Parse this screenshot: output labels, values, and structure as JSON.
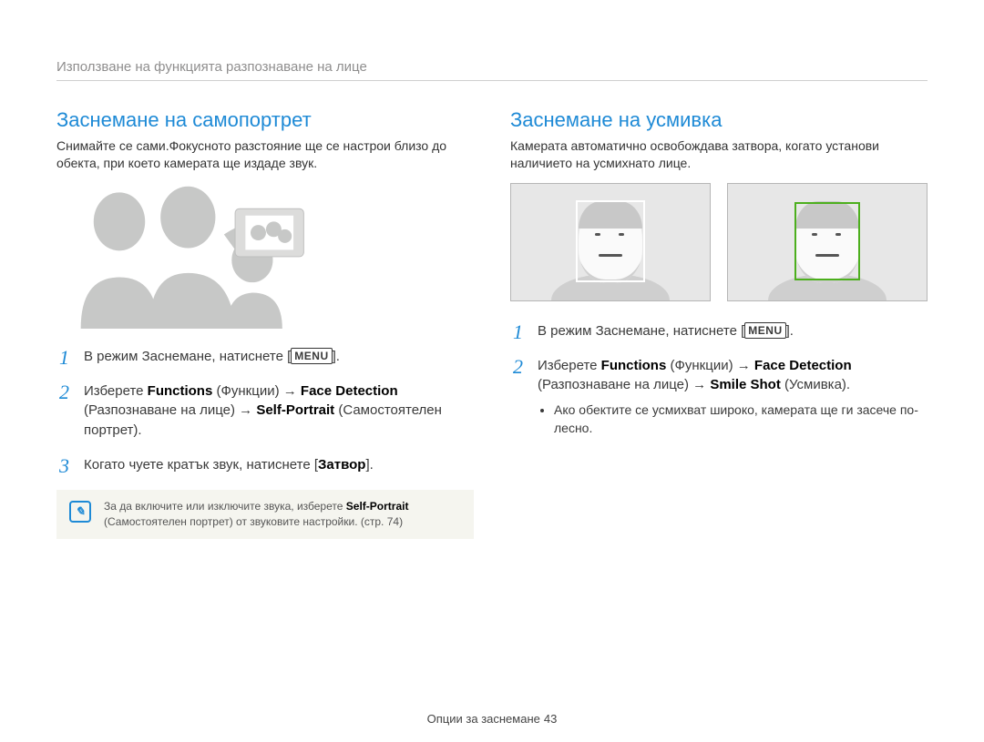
{
  "breadcrumb": "Използване на функцията разпознаване на лице",
  "left": {
    "heading": "Заснемане на самопортрет",
    "intro": "Снимайте се сами.Фокусното разстояние ще се настрои близо до обекта, при което камерата ще издаде звук.",
    "step1_pre": "В режим Заснемане, натиснете [",
    "step1_menu": "MENU",
    "step1_post": "].",
    "step2_a": "Изберете ",
    "step2_b": "Functions",
    "step2_c": " (Функции) → ",
    "step2_d": "Face Detection",
    "step2_e": " (Разпознаване на лице) → ",
    "step2_f": "Self-Portrait",
    "step2_g": " (Самостоятелен портрет).",
    "step3_a": "Когато чуете кратък звук, натиснете [",
    "step3_b": "Затвор",
    "step3_c": "].",
    "note_a": "За да включите или изключите звука, изберете ",
    "note_b": "Self-Portrait",
    "note_c": " (Самостоятелен портрет) от звуковите настройки. (стр. 74)"
  },
  "right": {
    "heading": "Заснемане на усмивка",
    "intro": "Камерата автоматично освобождава затвора, когато установи наличието на усмихнато лице.",
    "step1_pre": "В режим Заснемане, натиснете [",
    "step1_menu": "MENU",
    "step1_post": "].",
    "step2_a": "Изберете ",
    "step2_b": "Functions",
    "step2_c": " (Функции) → ",
    "step2_d": "Face Detection",
    "step2_e": " (Разпознаване на лице) → ",
    "step2_f": "Smile Shot",
    "step2_g": " (Усмивка).",
    "bullet": "Ако обектите се усмихват широко, камерата ще ги засече по-лесно."
  },
  "footer_label": "Опции за заснемане",
  "footer_page": "43"
}
